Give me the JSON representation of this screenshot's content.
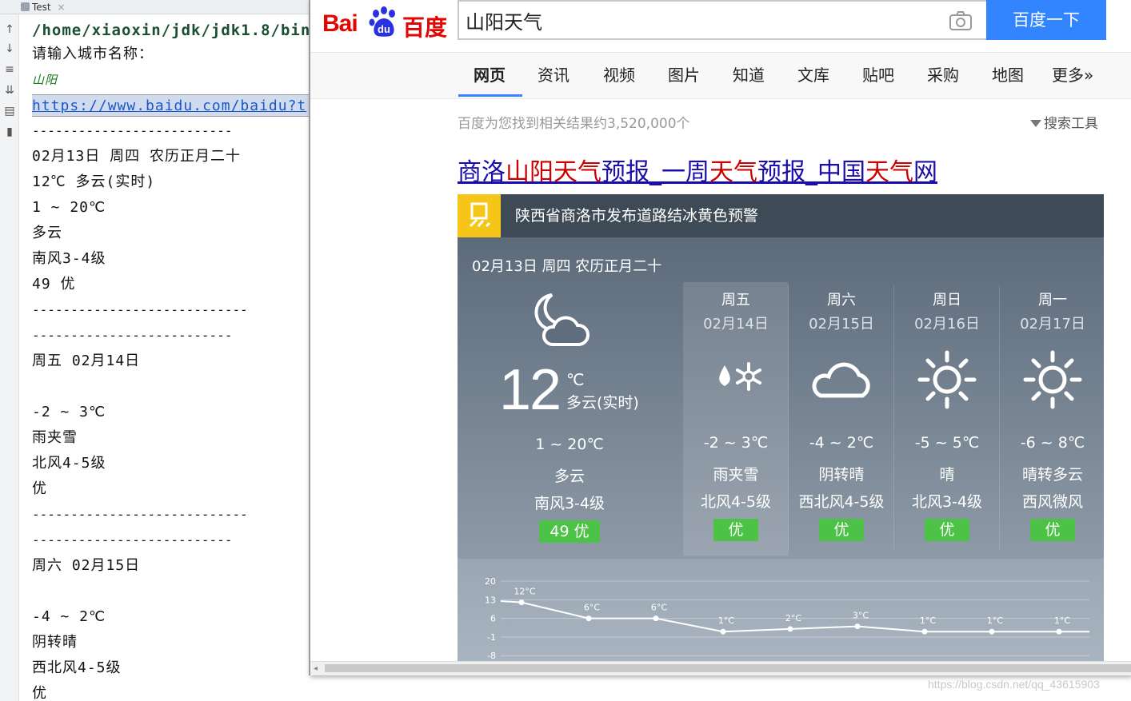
{
  "console": {
    "tab_label": "Test",
    "tab_close": "×",
    "lines": [
      "/home/xiaoxin/jdk/jdk1.8/bin/",
      "请输入城市名称：",
      "山阳",
      "https://www.baidu.com/baidu?t",
      "--------------------------",
      "02月13日 周四 农历正月二十",
      "12℃ 多云(实时)",
      "1 ~ 20℃",
      "多云",
      "南风3-4级",
      "49 优",
      "----------------------------",
      "--------------------------",
      "周五 02月14日",
      "",
      "-2 ~ 3℃",
      "雨夹雪",
      "北风4-5级",
      "优",
      "----------------------------",
      "--------------------------",
      "周六 02月15日",
      "",
      "-4 ~ 2℃",
      "阴转晴",
      "西北风4-5级",
      "优"
    ]
  },
  "baidu": {
    "logo_bai": "Bai",
    "logo_du": "du",
    "logo_cn": "百度",
    "search_value": "山阳天气",
    "search_button": "百度一下",
    "nav": [
      "网页",
      "资讯",
      "视频",
      "图片",
      "知道",
      "文库",
      "贴吧",
      "采购",
      "地图",
      "更多»"
    ],
    "stats": "百度为您找到相关结果约3,520,000个",
    "tools": "搜索工具",
    "result_title_parts": [
      "商洛",
      "山阳天气",
      "预报_一周",
      "天气",
      "预报_中国",
      "天气",
      "网"
    ],
    "colors": {
      "accent": "#3385ff",
      "brand_red": "#e10602",
      "good_badge": "#4cc346",
      "alert_yellow": "#f5c518"
    }
  },
  "weather": {
    "alert": "陕西省商洛市发布道路结冰黄色预警",
    "today": {
      "date": "02月13日 周四 农历正月二十",
      "temp": "12",
      "unit": "℃",
      "cond_now": "多云(实时)",
      "range": "1 ~ 20℃",
      "cond": "多云",
      "wind": "南风3-4级",
      "aqi": "49  优",
      "icon": "moon-cloud-icon"
    },
    "days": [
      {
        "name": "周五",
        "date": "02月14日",
        "range": "-2 ~ 3℃",
        "cond": "雨夹雪",
        "wind": "北风4-5级",
        "aqi": "优",
        "icon": "sleet-icon"
      },
      {
        "name": "周六",
        "date": "02月15日",
        "range": "-4 ~ 2℃",
        "cond": "阴转晴",
        "wind": "西北风4-5级",
        "aqi": "优",
        "icon": "cloud-icon"
      },
      {
        "name": "周日",
        "date": "02月16日",
        "range": "-5 ~ 5℃",
        "cond": "晴",
        "wind": "北风3-4级",
        "aqi": "优",
        "icon": "sun-icon"
      },
      {
        "name": "周一",
        "date": "02月17日",
        "range": "-6 ~ 8℃",
        "cond": "晴转多云",
        "wind": "西风微风",
        "aqi": "优",
        "icon": "sun-icon"
      }
    ]
  },
  "chart_data": {
    "type": "line",
    "y_ticks": [
      20,
      13,
      6,
      -1,
      -8
    ],
    "ylim": [
      -8,
      20
    ],
    "values": [
      12,
      6,
      6,
      1,
      2,
      3,
      1,
      1,
      1
    ],
    "labels": [
      "12°C",
      "6°C",
      "6°C",
      "1°C",
      "2°C",
      "3°C",
      "1°C",
      "1°C",
      "1°C"
    ],
    "grid": true
  },
  "watermark": "https://blog.csdn.net/qq_43615903"
}
